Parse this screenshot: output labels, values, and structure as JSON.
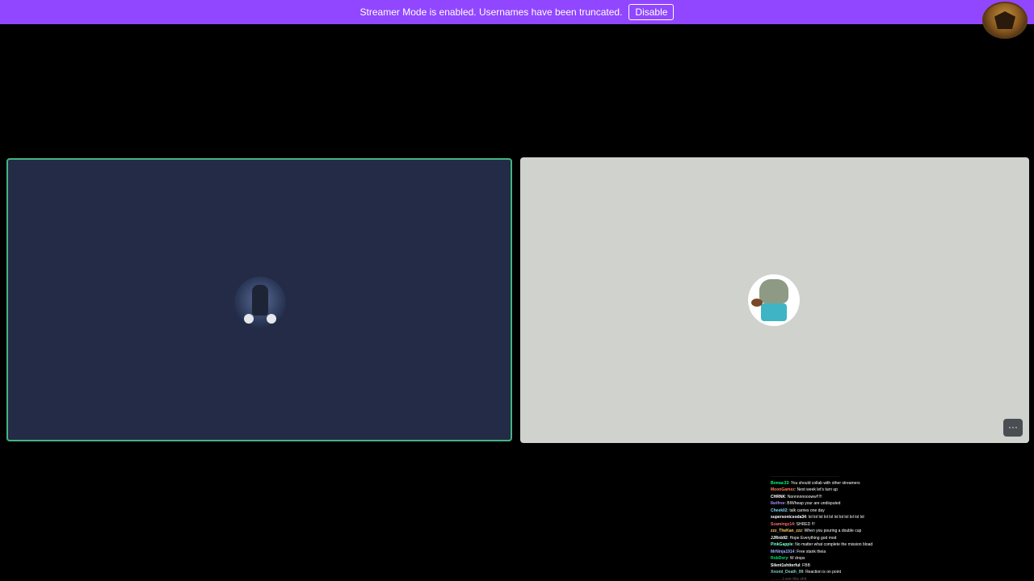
{
  "banner": {
    "message": "Streamer Mode is enabled. Usernames have been truncated.",
    "disable_label": "Disable",
    "color": "#9147ff"
  },
  "server_icon": "server-crest-icon",
  "tiles": {
    "left": {
      "background": "#232b46",
      "speaking_border": "#43b581",
      "avatar_icon": "user-avatar-motorcycle"
    },
    "right": {
      "background": "#cfd2cd",
      "avatar_icon": "user-avatar-hulk",
      "more_label": "···"
    }
  },
  "chat": {
    "lines": [
      {
        "user": "………………",
        "text": "……………………………",
        "color": "#9aa0a6",
        "faded": true
      },
      {
        "user": "Bomac33",
        "text": ": You should collab with other streamers",
        "color": "#00ff7f"
      },
      {
        "user": "MoonGamez",
        "text": ": Next week let's turn up",
        "color": "#ff7f50"
      },
      {
        "user": "CHRNK",
        "text": ": Nonnnnnoooww!!!!!",
        "color": "#ffffff"
      },
      {
        "user": "Ikeifree",
        "text": ": BIWheap your are undisputed",
        "color": "#b18cff"
      },
      {
        "user": "Cheek02",
        "text": ": talk carries one day",
        "color": "#7fdbff"
      },
      {
        "user": "supersonicsoda34",
        "text": ": lol lol lol lol lol lol lol lol lol lol lol",
        "color": "#ffffff"
      },
      {
        "user": "Scamingz14",
        "text": ": SHRED !!!",
        "color": "#ff6b6b"
      },
      {
        "user": "zzz_TheKan_zzz",
        "text": ": When you pouring a double cup",
        "color": "#ffd166"
      },
      {
        "user": "JJRnb92",
        "text": ": Hope Everything god mod",
        "color": "#ffffff"
      },
      {
        "user": "PinkGapple",
        "text": ": No matter what complete the mission bload",
        "color": "#7fffd4"
      },
      {
        "user": "MrNinja1914",
        "text": ": Free stank theia",
        "color": "#9fa8ff"
      },
      {
        "user": "RobDory",
        "text": ": W drops",
        "color": "#00e676"
      },
      {
        "user": "Silent1shtterful",
        "text": ": FBB",
        "color": "#ffffff"
      },
      {
        "user": "Xnomi_Death_99",
        "text": ": Reaction is on point",
        "color": "#80cbc4"
      },
      {
        "user": "………",
        "text": "Love this shit",
        "color": "#9aa0a6",
        "faded": true
      }
    ]
  }
}
